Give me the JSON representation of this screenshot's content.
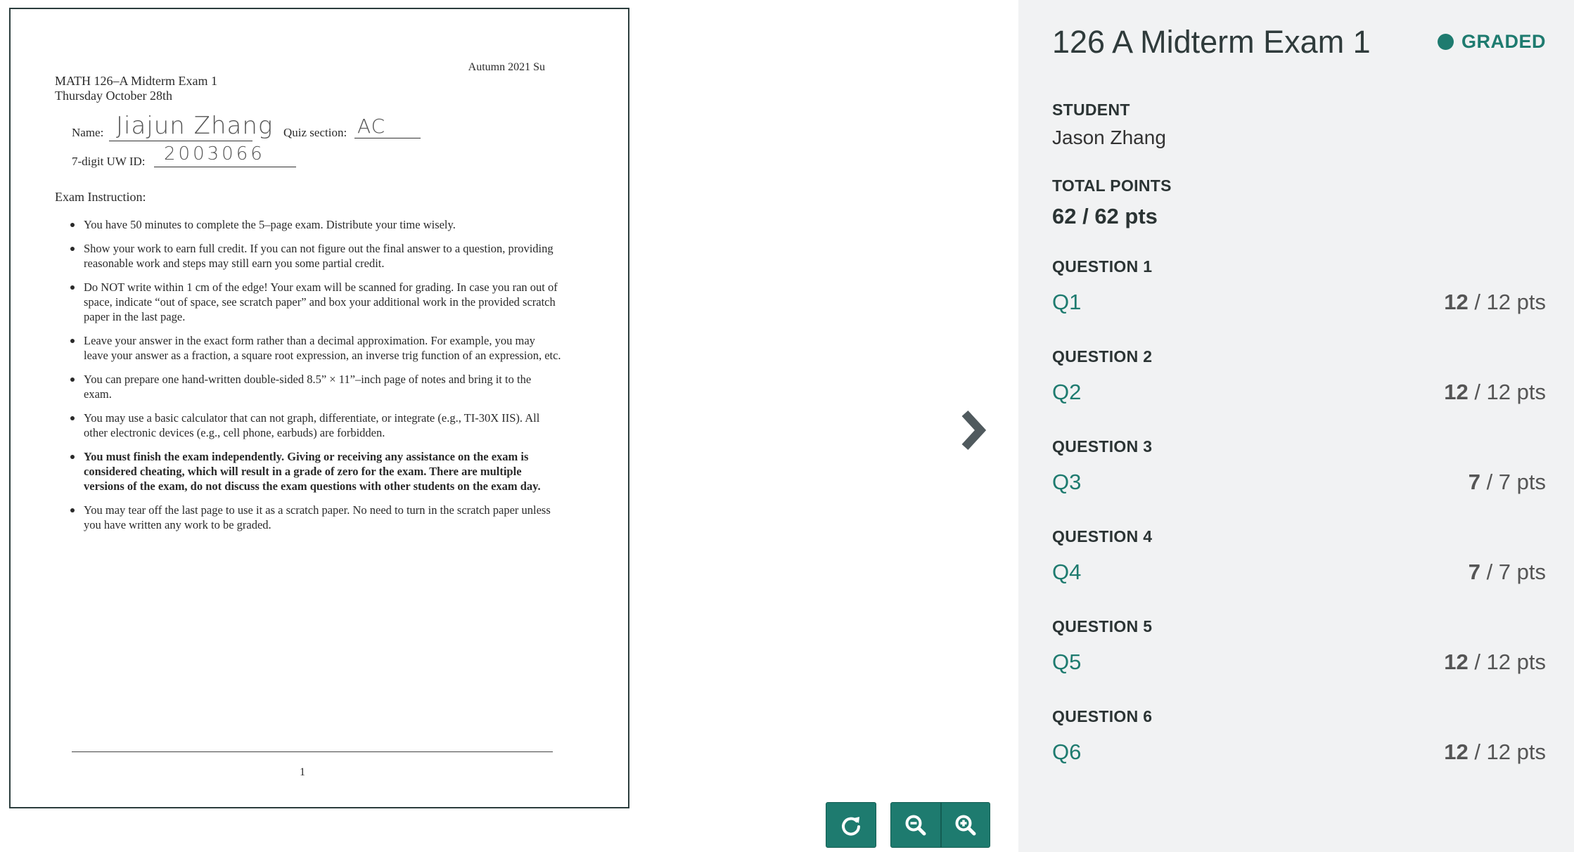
{
  "document": {
    "term": "Autumn 2021  Su",
    "course": "MATH 126–A   Midterm Exam 1",
    "date": "Thursday October 28th",
    "name_label": "Name:",
    "name_value": "Jiajun Zhang",
    "quiz_section_label": "Quiz section:",
    "quiz_section_value": "AC",
    "uwid_label": "7-digit UW ID:",
    "uwid_value": "2003066",
    "instructions_heading": "Exam Instruction:",
    "instructions": [
      {
        "text": "You have 50 minutes to complete the 5–page exam. Distribute your time wisely.",
        "bold": false
      },
      {
        "text": "Show your work to earn full credit. If you can not figure out the final answer to a question, providing reasonable work and steps may still earn you some partial credit.",
        "bold": false
      },
      {
        "text": "Do NOT write within 1 cm of the edge! Your exam will be scanned for grading. In case you ran out of space, indicate “out of space, see scratch paper” and box your additional work in the provided scratch paper in the last page.",
        "bold": false
      },
      {
        "text": "Leave your answer in the exact form rather than a decimal approximation. For example, you may leave your answer as a fraction, a square root expression, an inverse trig function of an expression, etc.",
        "bold": false
      },
      {
        "text": "You can prepare one hand-written double-sided 8.5” × 11”–inch page of notes and bring it to the exam.",
        "bold": false
      },
      {
        "text": "You may use a basic calculator that can not graph, differentiate, or integrate (e.g., TI-30X IIS). All other electronic devices (e.g., cell phone, earbuds) are forbidden.",
        "bold": false
      },
      {
        "text": "You must finish the exam independently. Giving or receiving any assistance on the exam is considered cheating, which will result in a grade of zero for the exam. There are multiple versions of the exam, do not discuss the exam questions with other students on the exam day.",
        "bold": true
      },
      {
        "text": "You may tear off the last page to use it as a scratch paper. No need to turn in the scratch paper unless you have written any work to be graded.",
        "bold": false
      }
    ],
    "page_number": "1"
  },
  "viewer": {
    "next_icon": "chevron-right-icon",
    "rotate_icon": "rotate-icon",
    "zoom_out_icon": "zoom-out-icon",
    "zoom_in_icon": "zoom-in-icon"
  },
  "panel": {
    "title": "126 A Midterm Exam 1",
    "status": "GRADED",
    "student_label": "STUDENT",
    "student_name": "Jason Zhang",
    "total_label": "TOTAL POINTS",
    "total_value": "62 / 62 pts",
    "questions": [
      {
        "label": "QUESTION 1",
        "link": "Q1",
        "earned": "12",
        "max": " / 12 pts"
      },
      {
        "label": "QUESTION 2",
        "link": "Q2",
        "earned": "12",
        "max": " / 12 pts"
      },
      {
        "label": "QUESTION 3",
        "link": "Q3",
        "earned": "7",
        "max": " / 7 pts"
      },
      {
        "label": "QUESTION 4",
        "link": "Q4",
        "earned": "7",
        "max": " / 7 pts"
      },
      {
        "label": "QUESTION 5",
        "link": "Q5",
        "earned": "12",
        "max": " / 12 pts"
      },
      {
        "label": "QUESTION 6",
        "link": "Q6",
        "earned": "12",
        "max": " / 12 pts"
      }
    ]
  },
  "colors": {
    "accent": "#1e7b6f",
    "panel_bg": "#f1f2f3",
    "text_dark": "#2b3434"
  }
}
